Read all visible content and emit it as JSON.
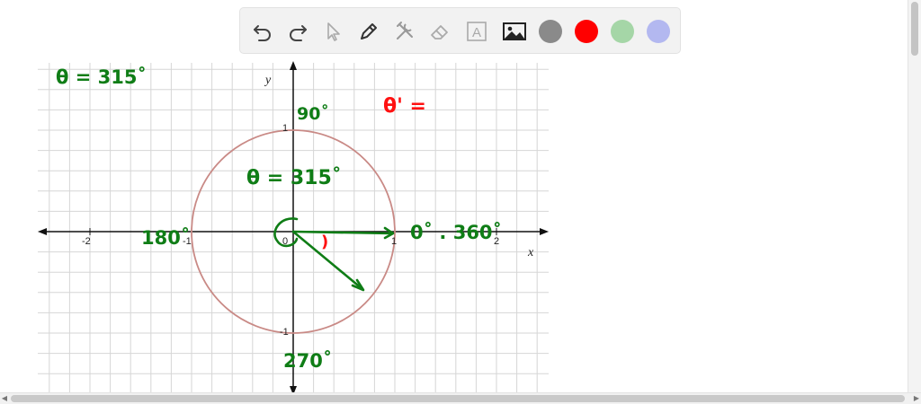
{
  "toolbar": {
    "tools": [
      {
        "name": "undo-icon"
      },
      {
        "name": "redo-icon"
      },
      {
        "name": "pointer-icon"
      },
      {
        "name": "pen-icon"
      },
      {
        "name": "tools-icon"
      },
      {
        "name": "eraser-icon"
      },
      {
        "name": "text-icon",
        "glyph": "A"
      },
      {
        "name": "image-icon"
      }
    ],
    "colors": [
      "#8a8a8a",
      "#ff0000",
      "#a5d6a7",
      "#b3b8f0"
    ]
  },
  "graph": {
    "x_ticks": [
      "-2",
      "-1",
      "0",
      "1",
      "2"
    ],
    "y_ticks": [
      "1",
      "-1"
    ],
    "x_label": "x",
    "y_label": "y"
  },
  "annotations": {
    "theta_top_left": "θ = 315˚",
    "deg_90": "90˚",
    "theta_prime": "θ' =",
    "theta_center": "θ = 315˚",
    "deg_180": "180˚",
    "deg_0_360": "0˚ . 360˚",
    "deg_270": "270˚",
    "red_mark": ")"
  },
  "colors": {
    "ink_green": "#0f7d16",
    "ink_red": "#ff1111",
    "circle": "#c98a86",
    "grid": "#d6d6d6"
  }
}
